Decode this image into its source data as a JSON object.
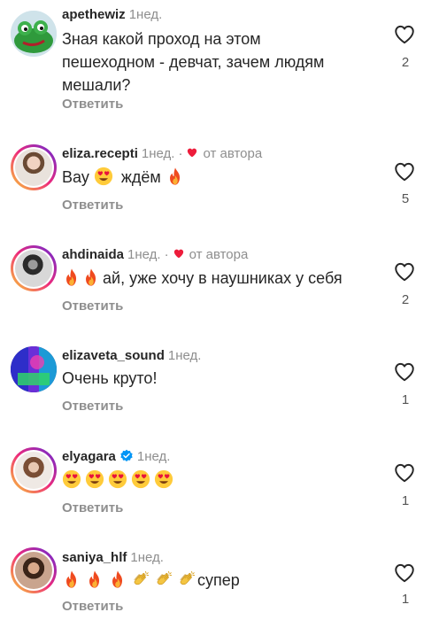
{
  "comments": [
    {
      "username": "apethewiz",
      "time": "1нед.",
      "text_lines": [
        "Зная какой проход на этом",
        "пешеходном - девчат, зачем людям",
        "мешали?"
      ],
      "reply_label": "Ответить",
      "likes": "2",
      "avatar": "green-frog"
    },
    {
      "username": "eliza.recepti",
      "time": "1нед.",
      "author_label": "от автора",
      "text_before": "Вау",
      "text_middle": "ждём",
      "reply_label": "Ответить",
      "likes": "5",
      "avatar": "woman-photo"
    },
    {
      "username": "ahdinaida",
      "time": "1нед.",
      "author_label": "от автора",
      "text": "ай, уже хочу в наушниках у себя",
      "reply_label": "Ответить",
      "likes": "2",
      "avatar": "bw-portrait"
    },
    {
      "username": "elizaveta_sound",
      "time": "1нед.",
      "text": "Очень круто!",
      "reply_label": "Ответить",
      "likes": "1",
      "avatar": "neon-abstract"
    },
    {
      "username": "elyagara",
      "time": "1нед.",
      "reply_label": "Ответить",
      "likes": "1",
      "avatar": "woman-portrait",
      "verified": true
    },
    {
      "username": "saniya_hlf",
      "time": "1нед.",
      "text": "супер",
      "reply_label": "Ответить",
      "likes": "1",
      "avatar": "woman-smiling"
    }
  ],
  "colors": {
    "author_heart": "#ed1c3b",
    "verified": "#0095f6",
    "muted": "#8e8e8e"
  }
}
